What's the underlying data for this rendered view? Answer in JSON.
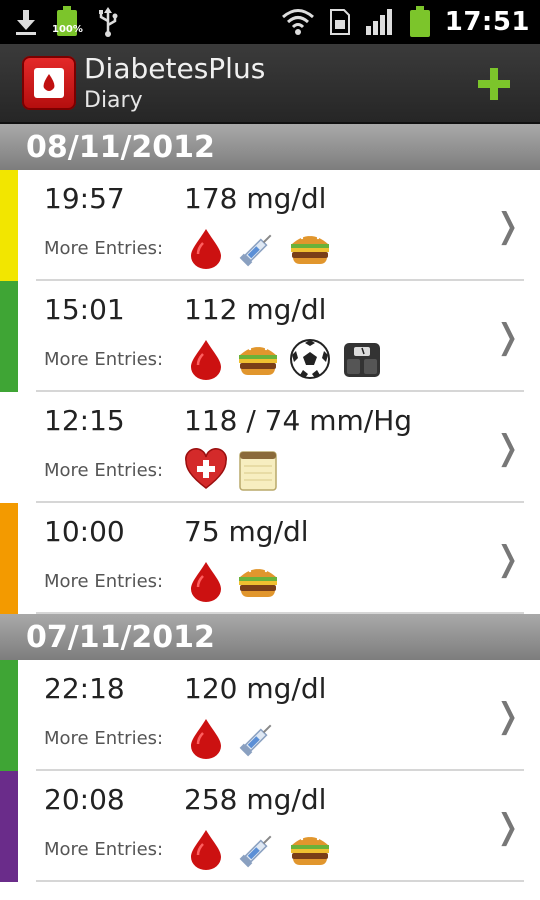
{
  "status_bar": {
    "battery_label": "100%",
    "time": "17:51",
    "icons": [
      "download-icon",
      "battery-icon",
      "usb-icon",
      "wifi-icon",
      "sim-icon",
      "signal-icon",
      "battery-icon"
    ]
  },
  "app": {
    "title": "DiabetesPlus",
    "subtitle": "Diary",
    "add_icon": "plus-icon",
    "accent_color": "#7cc52b"
  },
  "more_label": "More Entries:",
  "groups": [
    {
      "date": "08/11/2012",
      "entries": [
        {
          "time": "19:57",
          "value": "178 mg/dl",
          "stripe": "#f2e600",
          "icons": [
            "blood-drop-icon",
            "syringe-icon",
            "burger-icon"
          ]
        },
        {
          "time": "15:01",
          "value": "112 mg/dl",
          "stripe": "#3fa535",
          "icons": [
            "blood-drop-icon",
            "burger-icon",
            "soccer-ball-icon",
            "scale-icon"
          ]
        },
        {
          "time": "12:15",
          "value": "118 / 74 mm/Hg",
          "stripe": "#ffffff",
          "icons": [
            "heart-icon",
            "notepad-icon"
          ]
        },
        {
          "time": "10:00",
          "value": "75 mg/dl",
          "stripe": "#f39a00",
          "icons": [
            "blood-drop-icon",
            "burger-icon"
          ]
        }
      ]
    },
    {
      "date": "07/11/2012",
      "entries": [
        {
          "time": "22:18",
          "value": "120 mg/dl",
          "stripe": "#3fa535",
          "icons": [
            "blood-drop-icon",
            "syringe-icon"
          ]
        },
        {
          "time": "20:08",
          "value": "258 mg/dl",
          "stripe": "#6a2c8a",
          "icons": [
            "blood-drop-icon",
            "syringe-icon",
            "burger-icon"
          ]
        }
      ]
    }
  ]
}
